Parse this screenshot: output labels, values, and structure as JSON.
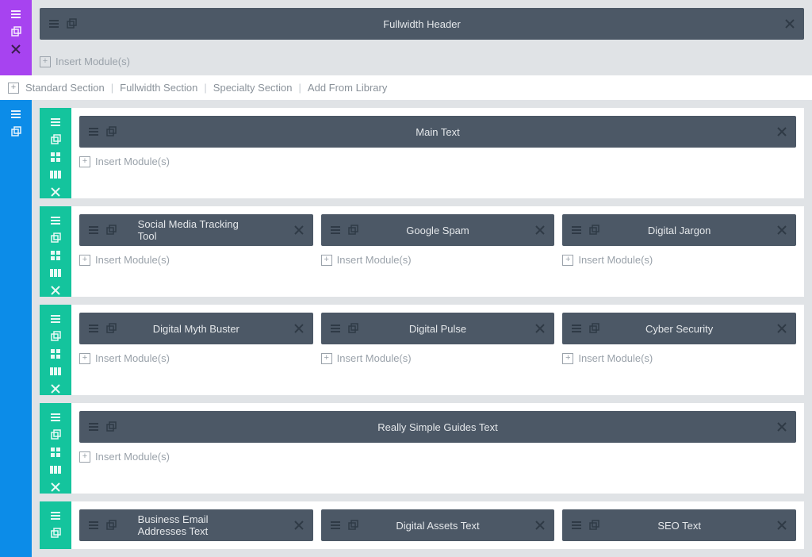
{
  "colors": {
    "purple": "#a743f0",
    "blue": "#0c8ce8",
    "teal": "#14c49d",
    "moduleBar": "#4c5866",
    "sectionBg": "#e0e3e6"
  },
  "fullwidthSection": {
    "module": {
      "title": "Fullwidth Header"
    },
    "insertLabel": "Insert Module(s)"
  },
  "addSectionOptions": {
    "standard": "Standard Section",
    "fullwidth": "Fullwidth Section",
    "specialty": "Specialty Section",
    "library": "Add From Library"
  },
  "standardSection": {
    "rows": [
      {
        "columns": [
          {
            "title": "Main Text",
            "insertLabel": "Insert Module(s)"
          }
        ]
      },
      {
        "columns": [
          {
            "title": "Social Media Tracking Tool",
            "insertLabel": "Insert Module(s)"
          },
          {
            "title": "Google Spam",
            "insertLabel": "Insert Module(s)"
          },
          {
            "title": "Digital Jargon",
            "insertLabel": "Insert Module(s)"
          }
        ]
      },
      {
        "columns": [
          {
            "title": "Digital Myth Buster",
            "insertLabel": "Insert Module(s)"
          },
          {
            "title": "Digital Pulse",
            "insertLabel": "Insert Module(s)"
          },
          {
            "title": "Cyber Security",
            "insertLabel": "Insert Module(s)"
          }
        ]
      },
      {
        "columns": [
          {
            "title": "Really Simple Guides Text",
            "insertLabel": "Insert Module(s)"
          }
        ]
      },
      {
        "columns": [
          {
            "title": "Business Email Addresses Text"
          },
          {
            "title": "Digital Assets Text"
          },
          {
            "title": "SEO Text"
          }
        ]
      }
    ]
  }
}
